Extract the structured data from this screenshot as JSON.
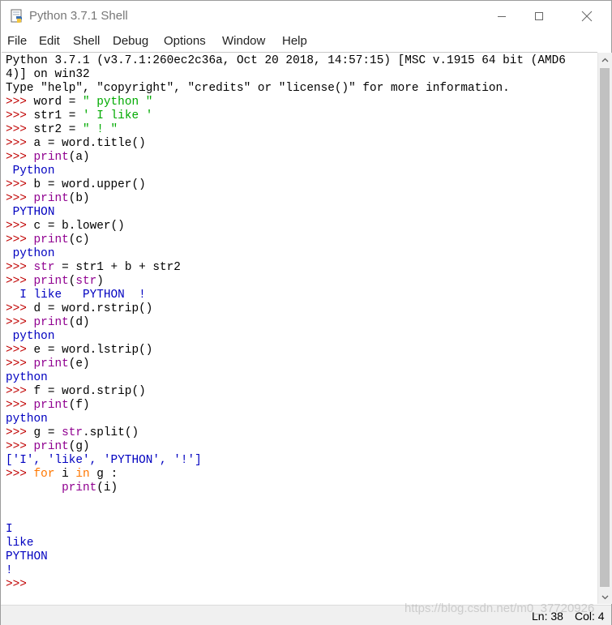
{
  "window": {
    "title": "Python 3.7.1 Shell",
    "app_icon": "python-idle-icon",
    "controls": {
      "minimize_icon": "minimize-icon",
      "maximize_icon": "maximize-icon",
      "close_icon": "close-icon"
    }
  },
  "menu": [
    "File",
    "Edit",
    "Shell",
    "Debug",
    "Options",
    "Window",
    "Help"
  ],
  "colors": {
    "keyword": "#ff7700",
    "builtin": "#900090",
    "string": "#00aa00",
    "output": "#0000c0",
    "prompt": "#c00000"
  },
  "shell": {
    "lines": [
      [
        {
          "t": "Python 3.7.1 (v3.7.1:260ec2c36a, Oct 20 2018, 14:57:15) [MSC v.1915 64 bit (AMD6"
        }
      ],
      [
        {
          "t": "4)] on win32"
        }
      ],
      [
        {
          "t": "Type \"help\", \"copyright\", \"credits\" or \"license()\" for more information."
        }
      ],
      [
        {
          "t": ">>> ",
          "c": "p"
        },
        {
          "t": "word = "
        },
        {
          "t": "\" python \"",
          "c": "s"
        }
      ],
      [
        {
          "t": ">>> ",
          "c": "p"
        },
        {
          "t": "str1 = "
        },
        {
          "t": "' I like '",
          "c": "s"
        }
      ],
      [
        {
          "t": ">>> ",
          "c": "p"
        },
        {
          "t": "str2 = "
        },
        {
          "t": "\" ! \"",
          "c": "s"
        }
      ],
      [
        {
          "t": ">>> ",
          "c": "p"
        },
        {
          "t": "a = word.title()"
        }
      ],
      [
        {
          "t": ">>> ",
          "c": "p"
        },
        {
          "t": "print",
          "c": "b"
        },
        {
          "t": "(a)"
        }
      ],
      [
        {
          "t": " Python",
          "c": "o"
        }
      ],
      [
        {
          "t": ">>> ",
          "c": "p"
        },
        {
          "t": "b = word.upper()"
        }
      ],
      [
        {
          "t": ">>> ",
          "c": "p"
        },
        {
          "t": "print",
          "c": "b"
        },
        {
          "t": "(b)"
        }
      ],
      [
        {
          "t": " PYTHON",
          "c": "o"
        }
      ],
      [
        {
          "t": ">>> ",
          "c": "p"
        },
        {
          "t": "c = b.lower()"
        }
      ],
      [
        {
          "t": ">>> ",
          "c": "p"
        },
        {
          "t": "print",
          "c": "b"
        },
        {
          "t": "(c)"
        }
      ],
      [
        {
          "t": " python",
          "c": "o"
        }
      ],
      [
        {
          "t": ">>> ",
          "c": "p"
        },
        {
          "t": "str",
          "c": "b"
        },
        {
          "t": " = str1 + b + str2"
        }
      ],
      [
        {
          "t": ">>> ",
          "c": "p"
        },
        {
          "t": "print",
          "c": "b"
        },
        {
          "t": "("
        },
        {
          "t": "str",
          "c": "b"
        },
        {
          "t": ")"
        }
      ],
      [
        {
          "t": "  I like   PYTHON  !",
          "c": "o"
        }
      ],
      [
        {
          "t": ">>> ",
          "c": "p"
        },
        {
          "t": "d = word.rstrip()"
        }
      ],
      [
        {
          "t": ">>> ",
          "c": "p"
        },
        {
          "t": "print",
          "c": "b"
        },
        {
          "t": "(d)"
        }
      ],
      [
        {
          "t": " python",
          "c": "o"
        }
      ],
      [
        {
          "t": ">>> ",
          "c": "p"
        },
        {
          "t": "e = word.lstrip()"
        }
      ],
      [
        {
          "t": ">>> ",
          "c": "p"
        },
        {
          "t": "print",
          "c": "b"
        },
        {
          "t": "(e)"
        }
      ],
      [
        {
          "t": "python",
          "c": "o"
        }
      ],
      [
        {
          "t": ">>> ",
          "c": "p"
        },
        {
          "t": "f = word.strip()"
        }
      ],
      [
        {
          "t": ">>> ",
          "c": "p"
        },
        {
          "t": "print",
          "c": "b"
        },
        {
          "t": "(f)"
        }
      ],
      [
        {
          "t": "python",
          "c": "o"
        }
      ],
      [
        {
          "t": ">>> ",
          "c": "p"
        },
        {
          "t": "g = "
        },
        {
          "t": "str",
          "c": "b"
        },
        {
          "t": ".split()"
        }
      ],
      [
        {
          "t": ">>> ",
          "c": "p"
        },
        {
          "t": "print",
          "c": "b"
        },
        {
          "t": "(g)"
        }
      ],
      [
        {
          "t": "['I', 'like', 'PYTHON', '!']",
          "c": "o"
        }
      ],
      [
        {
          "t": ">>> ",
          "c": "p"
        },
        {
          "t": "for",
          "c": "k"
        },
        {
          "t": " i "
        },
        {
          "t": "in",
          "c": "k"
        },
        {
          "t": " g :"
        }
      ],
      [
        {
          "t": "        "
        },
        {
          "t": "print",
          "c": "b"
        },
        {
          "t": "(i)"
        }
      ],
      [
        {
          "t": ""
        }
      ],
      [
        {
          "t": ""
        }
      ],
      [
        {
          "t": "I",
          "c": "o"
        }
      ],
      [
        {
          "t": "like",
          "c": "o"
        }
      ],
      [
        {
          "t": "PYTHON",
          "c": "o"
        }
      ],
      [
        {
          "t": "!",
          "c": "o"
        }
      ],
      [
        {
          "t": ">>> ",
          "c": "p"
        }
      ]
    ]
  },
  "status": {
    "ln": "Ln: 38",
    "col": "Col: 4"
  },
  "watermark": "https://blog.csdn.net/m0_37720926"
}
